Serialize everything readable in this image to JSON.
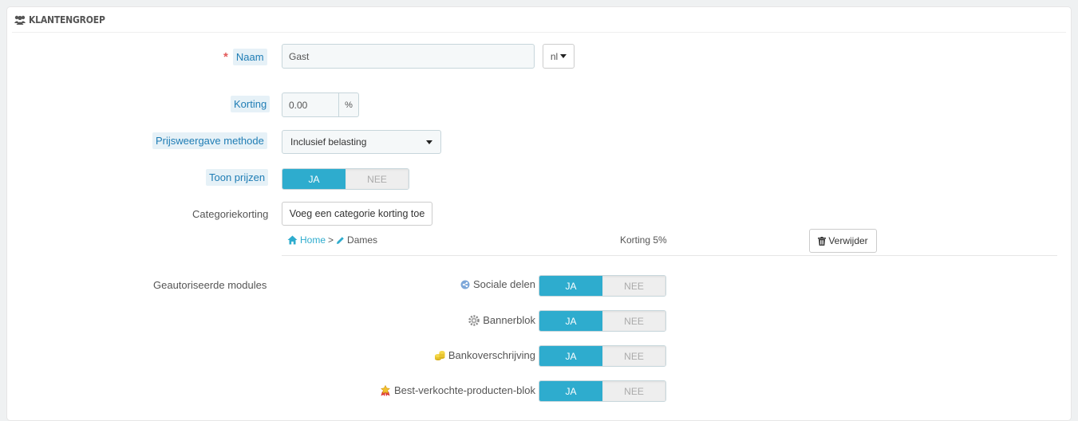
{
  "panel": {
    "title": "KLANTENGROEP",
    "icon": "users-icon"
  },
  "form": {
    "name": {
      "label": "Naam",
      "required_mark": "*",
      "value": "Gast",
      "lang": "nl"
    },
    "discount": {
      "label": "Korting",
      "value": "0.00",
      "unit": "%"
    },
    "price_display": {
      "label": "Prijsweergave methode",
      "selected": "Inclusief belasting"
    },
    "show_prices": {
      "label": "Toon prijzen",
      "yes": "JA",
      "no": "NEE",
      "value": "JA"
    },
    "category_discount": {
      "label": "Categoriekorting",
      "add_button": "Voeg een categorie korting toe",
      "rows": [
        {
          "home": "Home",
          "separator": ">",
          "category": "Dames",
          "discount": "Korting 5%",
          "delete": "Verwijder"
        }
      ]
    },
    "modules": {
      "label": "Geautoriseerde modules",
      "yes": "JA",
      "no": "NEE",
      "items": [
        {
          "name": "Sociale delen",
          "icon": "share-icon",
          "value": "JA"
        },
        {
          "name": "Bannerblok",
          "icon": "gear-icon",
          "value": "JA"
        },
        {
          "name": "Bankoverschrijving",
          "icon": "coins-icon",
          "value": "JA"
        },
        {
          "name": "Best-verkochte-producten-blok",
          "icon": "award-icon",
          "value": "JA"
        }
      ]
    }
  },
  "colors": {
    "accent": "#2eacce",
    "label_bg": "#e6f1f7",
    "label_text": "#1f7db5",
    "required": "#e35b5b"
  }
}
